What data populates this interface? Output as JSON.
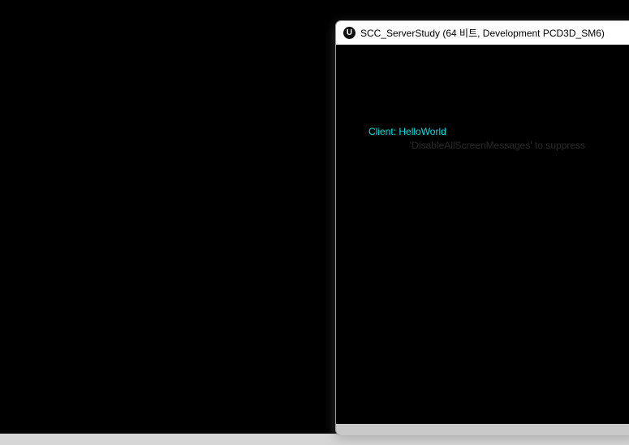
{
  "window": {
    "title": "SCC_ServerStudy (64 비트, Development PCD3D_SM6)",
    "logo_glyph": "U"
  },
  "viewport": {
    "debug_message": "Client: HelloWorld",
    "hint_message": "'DisableAllScreenMessages' to suppress"
  },
  "colors": {
    "debug_text": "#00e0e0",
    "background": "#000000",
    "title_bar": "#ffffff"
  },
  "icons": {
    "app_logo": "unreal-engine-logo"
  }
}
